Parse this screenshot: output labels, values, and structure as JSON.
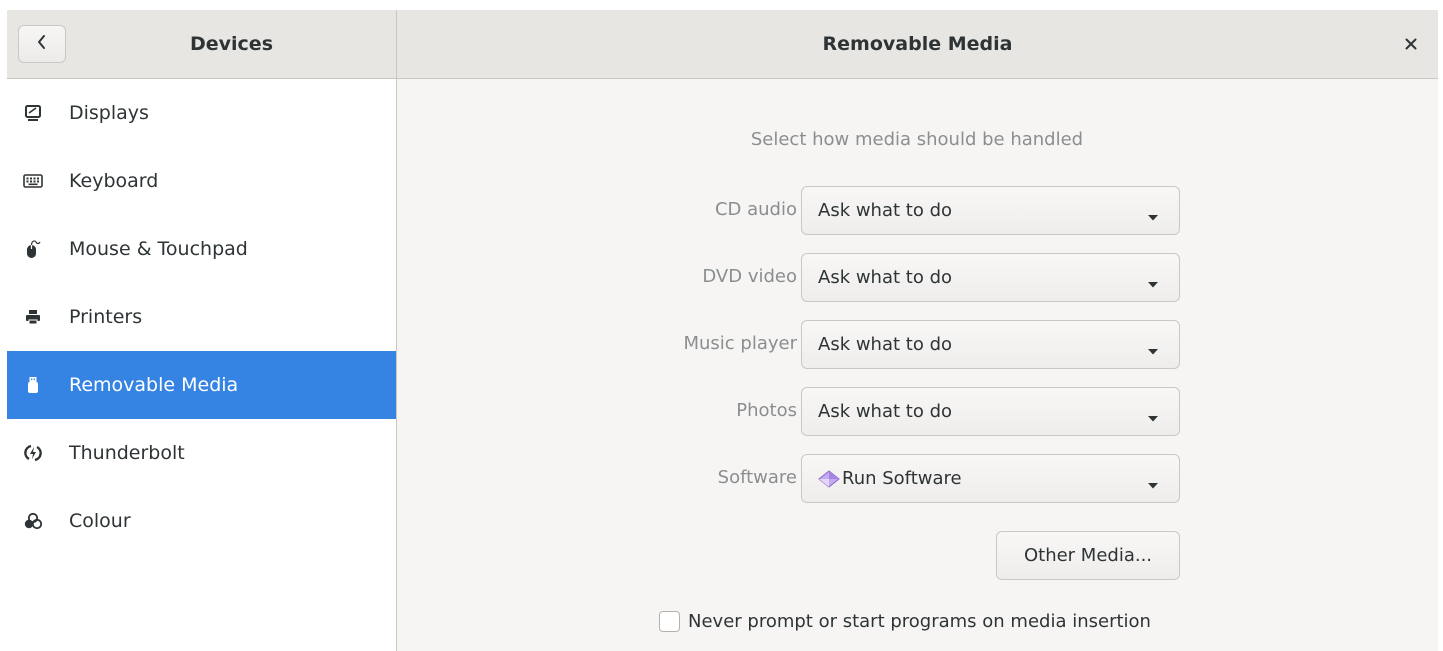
{
  "header": {
    "left_title": "Devices",
    "right_title": "Removable Media",
    "back_icon": "chevron-left-icon",
    "close_icon": "close-icon"
  },
  "sidebar": {
    "items": [
      {
        "label": "Displays",
        "icon": "display-icon"
      },
      {
        "label": "Keyboard",
        "icon": "keyboard-icon"
      },
      {
        "label": "Mouse & Touchpad",
        "icon": "mouse-icon"
      },
      {
        "label": "Printers",
        "icon": "printer-icon"
      },
      {
        "label": "Removable Media",
        "icon": "usb-drive-icon",
        "selected": true
      },
      {
        "label": "Thunderbolt",
        "icon": "thunderbolt-icon"
      },
      {
        "label": "Colour",
        "icon": "colour-icon"
      }
    ]
  },
  "main": {
    "subtitle": "Select how media should be handled",
    "rows": [
      {
        "label": "CD audio",
        "value": "Ask what to do"
      },
      {
        "label": "DVD video",
        "value": "Ask what to do"
      },
      {
        "label": "Music player",
        "value": "Ask what to do"
      },
      {
        "label": "Photos",
        "value": "Ask what to do"
      },
      {
        "label": "Software",
        "value": "Run Software",
        "value_icon": "software-diamond-icon"
      }
    ],
    "other_media_label": "Other Media...",
    "never_prompt_label": "Never prompt or start programs on media insertion",
    "never_prompt_checked": false
  },
  "colors": {
    "accent": "#3584e4",
    "window_bg": "#f6f5f4",
    "header_bg": "#e8e6e3",
    "dim_text": "#8b8e8f"
  }
}
